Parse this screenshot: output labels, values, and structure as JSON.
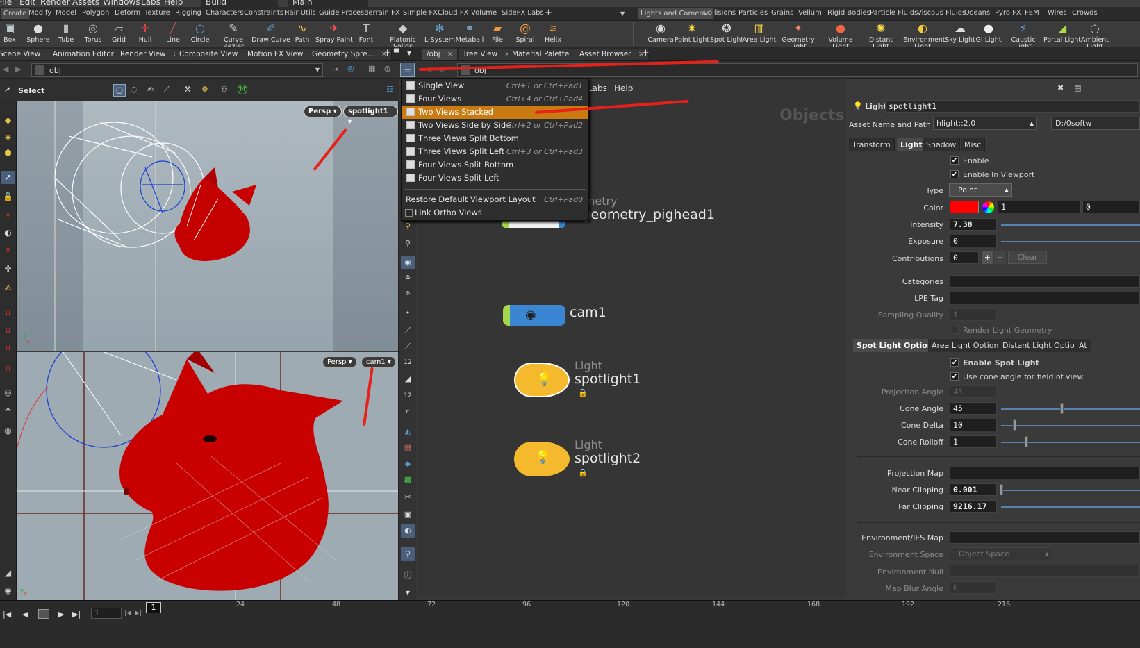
{
  "menubar": {
    "items": [
      "File",
      "Edit",
      "Render",
      "Assets",
      "Windows",
      "Labs",
      "Help"
    ],
    "desktop": "Build",
    "context": "Main"
  },
  "shelf_tabs_left": [
    "Create",
    "Modify",
    "Model",
    "Polygon",
    "Deform",
    "Texture",
    "Rigging",
    "Characters",
    "Constraints",
    "Hair Utils",
    "Guide Process",
    "Terrain FX",
    "Simple FX",
    "Cloud FX",
    "Volume",
    "SideFX Labs"
  ],
  "shelf_tabs_right": [
    "Lights and Cameras",
    "Collisions",
    "Particles",
    "Grains",
    "Vellum",
    "Rigid Bodies",
    "Particle Fluids",
    "Viscous Fluids",
    "Oceans",
    "Pyro FX",
    "FEM",
    "Wires",
    "Crowds"
  ],
  "tools_left": [
    "Box",
    "Sphere",
    "Tube",
    "Torus",
    "Grid",
    "Null",
    "Line",
    "Circle",
    "Curve Bezier",
    "Draw Curve",
    "Path",
    "Spray Paint",
    "Font",
    "Platonic Solids",
    "L-System",
    "Metaball",
    "File",
    "Spiral",
    "Helix"
  ],
  "tools_right": [
    "Camera",
    "Point Light",
    "Spot Light",
    "Area Light",
    "Geometry Light",
    "Volume Light",
    "Distant Light",
    "Environment Light",
    "Sky Light",
    "GI Light",
    "Caustic Light",
    "Portal Light",
    "Ambient Light"
  ],
  "pane_tabs_left": [
    "Scene View",
    "Animation Editor",
    "Render View",
    "Composite View",
    "Motion FX View",
    "Geometry Spre..."
  ],
  "pane_tabs_right": [
    "/obj",
    "Tree View",
    "Material Palette",
    "Asset Browser"
  ],
  "path_left": "obj",
  "path_right": "obj",
  "toolbar": {
    "select_label": "Select"
  },
  "viewport_top": {
    "view": "Persp",
    "camera": "spotlight1"
  },
  "viewport_bottom": {
    "view": "Persp",
    "camera": "cam1"
  },
  "layout_menu": {
    "items": [
      {
        "label": "Single View",
        "shortcut": "Ctrl+1 or Ctrl+Pad1"
      },
      {
        "label": "Four Views",
        "shortcut": "Ctrl+4 or Ctrl+Pad4"
      },
      {
        "label": "Two Views Stacked",
        "shortcut": ""
      },
      {
        "label": "Two Views Side by Side",
        "shortcut": "Ctrl+2 or Ctrl+Pad2"
      },
      {
        "label": "Three Views Split Bottom",
        "shortcut": ""
      },
      {
        "label": "Three Views Split Left",
        "shortcut": "Ctrl+3 or Ctrl+Pad3"
      },
      {
        "label": "Four Views Split Bottom",
        "shortcut": ""
      },
      {
        "label": "Four Views Split Left",
        "shortcut": ""
      }
    ],
    "restore": {
      "label": "Restore Default Viewport Layout",
      "shortcut": "Ctrl+Pad0"
    },
    "link": {
      "label": "Link Ortho Views"
    }
  },
  "network": {
    "menu": [
      "Labs",
      "Help"
    ],
    "context_label": "Objects",
    "nodes": [
      {
        "type": "ometry",
        "name": "tgeometry_pighead1"
      },
      {
        "type": "",
        "name": "cam1"
      },
      {
        "type": "Light",
        "name": "spotlight1"
      },
      {
        "type": "Light",
        "name": "spotlight2"
      }
    ]
  },
  "params": {
    "header_type": "Light",
    "header_name": "spotlight1",
    "asset_label": "Asset Name and Path",
    "asset_value": "hlight::2.0",
    "asset_path": "D:/0softw",
    "tabs": [
      "Transform",
      "Light",
      "Shadow",
      "Misc"
    ],
    "enable": "Enable",
    "enable_viewport": "Enable In Viewport",
    "type_label": "Type",
    "type_value": "Point",
    "color_label": "Color",
    "color_value": "1",
    "color_value2": "0",
    "intensity_label": "Intensity",
    "intensity": "7.38",
    "exposure_label": "Exposure",
    "exposure": "0",
    "contrib_label": "Contributions",
    "contrib": "0",
    "clear": "Clear",
    "categories_label": "Categories",
    "lpe_label": "LPE Tag",
    "sampling_label": "Sampling Quality",
    "sampling": "1",
    "render_geo": "Render Light Geometry",
    "subtabs": [
      "Spot Light Options",
      "Area Light Options",
      "Distant Light Options",
      "At"
    ],
    "enable_spot": "Enable Spot Light",
    "use_cone": "Use cone angle for field of view",
    "proj_angle_label": "Projection Angle",
    "proj_angle": "45",
    "cone_angle_label": "Cone Angle",
    "cone_angle": "45",
    "cone_delta_label": "Cone Delta",
    "cone_delta": "10",
    "cone_rolloff_label": "Cone Rolloff",
    "cone_rolloff": "1",
    "proj_map_label": "Projection Map",
    "near_label": "Near Clipping",
    "near": "0.001",
    "far_label": "Far Clipping",
    "far": "9216.17",
    "env_map_label": "Environment/IES Map",
    "env_space_label": "Environment Space",
    "env_space": "Object Space",
    "env_null_label": "Environment Null",
    "blur_label": "Map Blur Angle",
    "blur": "0"
  },
  "timeline": {
    "frame": "1",
    "frame_field": "1",
    "ticks": [
      "24",
      "48",
      "72",
      "96",
      "120",
      "144",
      "168",
      "192",
      "216"
    ]
  },
  "colors": {
    "accent": "#c97a10",
    "light_node": "#f5b92e",
    "cam_node": "#3a86d2",
    "light_color": "#ff0000",
    "arrow": "#e8201a"
  }
}
